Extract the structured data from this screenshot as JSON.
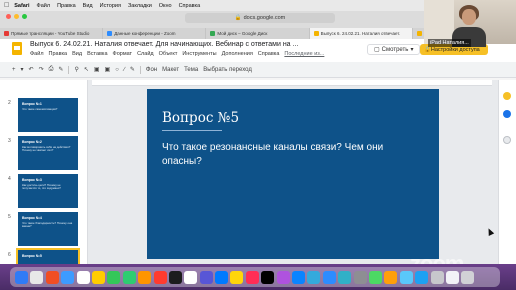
{
  "menubar": {
    "app_name": "Safari",
    "items": [
      "Файл",
      "Правка",
      "Вид",
      "История",
      "Закладки",
      "Окно",
      "Справка"
    ]
  },
  "browser": {
    "url": "docs.google.com",
    "tabs": [
      {
        "label": "Прямые трансляции - YouTube Studio",
        "color": "#e53935",
        "active": false
      },
      {
        "label": "Данные конференции - Zoom",
        "color": "#2d8cff",
        "active": false
      },
      {
        "label": "Мой диск – Google Диск",
        "color": "#34a853",
        "active": false
      },
      {
        "label": "Выпуск 6. 24.02.21. Наталия отвечает.",
        "color": "#f4b400",
        "active": true
      },
      {
        "label": "6. 24.02.21. Наталия отвечает. Для н...",
        "color": "#f4b400",
        "active": false
      }
    ]
  },
  "doc": {
    "title": "Выпуск 6. 24.02.21. Наталия отвечает. Для начинающих. Вебинар с ответами на ...",
    "menu": [
      "Файл",
      "Правка",
      "Вид",
      "Вставка",
      "Формат",
      "Слайд",
      "Объект",
      "Инструменты",
      "Дополнения",
      "Справка"
    ],
    "last_edit": "Последние из...",
    "watch_label": "Смотреть",
    "access_label": "Настройки доступа"
  },
  "toolbar": {
    "items": [
      "Фон",
      "Макет",
      "Тема",
      "Выбрать переход"
    ]
  },
  "filmstrip": {
    "slides": [
      {
        "num": "2",
        "title": "Вопрос №1",
        "body": "Что такое самомотивация?"
      },
      {
        "num": "3",
        "title": "Вопрос №2",
        "body": "Как мотивировать себя на действия? Почему не хватает сил?"
      },
      {
        "num": "4",
        "title": "Вопрос №3",
        "body": "Как достичь цели? Почему не получается то, что задумано?"
      },
      {
        "num": "5",
        "title": "Вопрос №4",
        "body": "Что такое благодарность? Почему она важна?"
      },
      {
        "num": "6",
        "title": "Вопрос №5",
        "body": "Что такое резонансные каналы связи? Чем они опасны?"
      }
    ],
    "selected_index": 4
  },
  "slide": {
    "title": "Вопрос №5",
    "body": "Что такое резонансные каналы связи? Чем они опасны?"
  },
  "zoom": {
    "participant_name": "iPad Наталия...",
    "watermark": "zoom"
  },
  "dock": {
    "apps": [
      "#2f7bf6",
      "#e8e8e8",
      "#f04e23",
      "#3d9bff",
      "#ffffff",
      "#ffcc00",
      "#34c759",
      "#2ecc71",
      "#ff9500",
      "#ff3b30",
      "#1c1c1e",
      "#ffffff",
      "#5856d6",
      "#007aff",
      "#ffd60a",
      "#ff2d55",
      "#000000",
      "#af52de",
      "#0a84ff",
      "#34aadc",
      "#2d8cff",
      "#30b0c7",
      "#8e8e93",
      "#4cd964",
      "#ff9f0a",
      "#5ac8fa",
      "#1da1f2",
      "#c7c7cc",
      "#f2f2f7",
      "#d1d1d6"
    ]
  }
}
